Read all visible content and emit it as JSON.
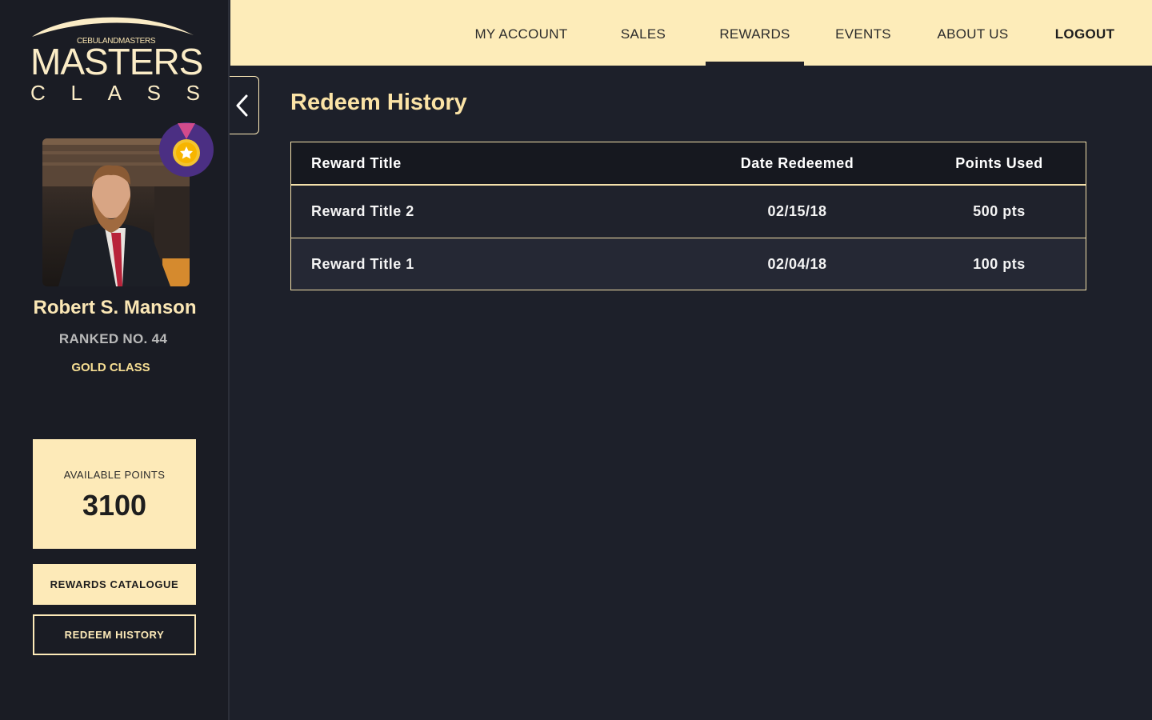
{
  "brand": {
    "company": "CEBULANDMASTERS",
    "title": "MASTERS",
    "subtitle": "CLASS"
  },
  "user": {
    "name": "Robert S. Manson",
    "rank": "RANKED NO. 44",
    "class": "GOLD CLASS",
    "medal_icon": "gold-star-medal-icon"
  },
  "points": {
    "label": "AVAILABLE POINTS",
    "value": "3100"
  },
  "sidebar_buttons": {
    "catalogue": "REWARDS CATALOGUE",
    "history": "REDEEM HISTORY"
  },
  "nav": {
    "items": [
      {
        "label": "MY ACCOUNT"
      },
      {
        "label": "SALES"
      },
      {
        "label": "REWARDS",
        "active": true
      },
      {
        "label": "EVENTS"
      },
      {
        "label": "ABOUT US"
      },
      {
        "label": "LOGOUT"
      }
    ]
  },
  "main": {
    "title": "Redeem History",
    "table": {
      "headers": [
        "Reward Title",
        "Date Redeemed",
        "Points Used"
      ],
      "rows": [
        {
          "title": "Reward Title 2",
          "date": "02/15/18",
          "points": "500 pts"
        },
        {
          "title": "Reward Title 1",
          "date": "02/04/18",
          "points": "100 pts"
        }
      ]
    }
  },
  "colors": {
    "accent": "#fdeab8",
    "background": "#1d202a",
    "sidebar": "#1a1c24",
    "title_gold": "#fbe3a6"
  }
}
